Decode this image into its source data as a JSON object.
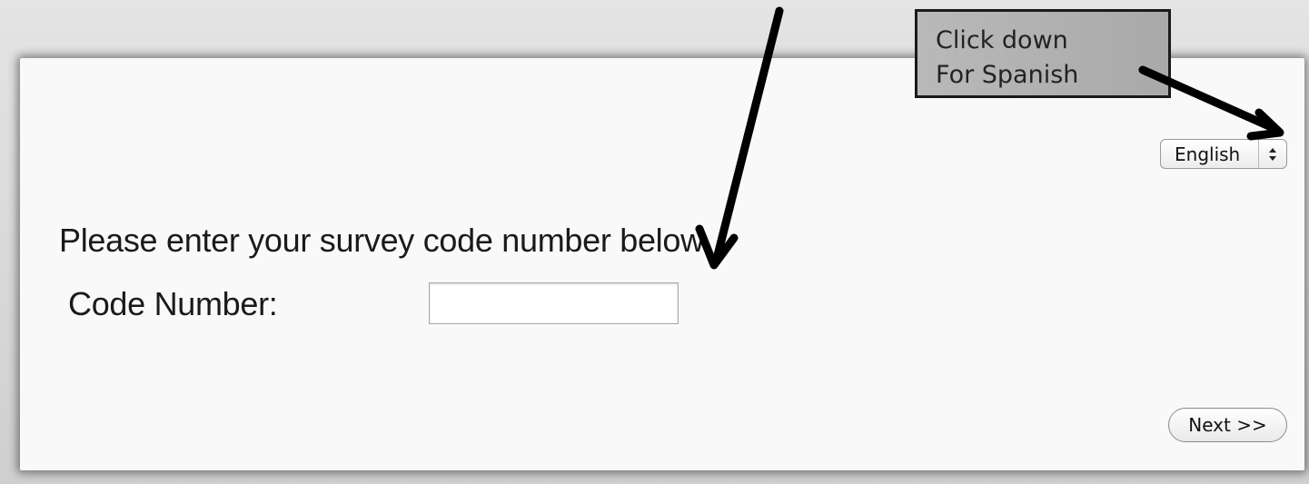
{
  "language_select": {
    "selected": "English"
  },
  "form": {
    "prompt": "Please enter your survey code number below",
    "code_label": "Code Number:",
    "code_value": ""
  },
  "next_button": {
    "label": "Next >>"
  },
  "annotation": {
    "line1": "Click down",
    "line2": "For Spanish"
  },
  "colors": {
    "panel": "#f9f9f9",
    "background": "#dcdcdc",
    "callout": "#b0b0b0",
    "arrow": "#000000"
  }
}
